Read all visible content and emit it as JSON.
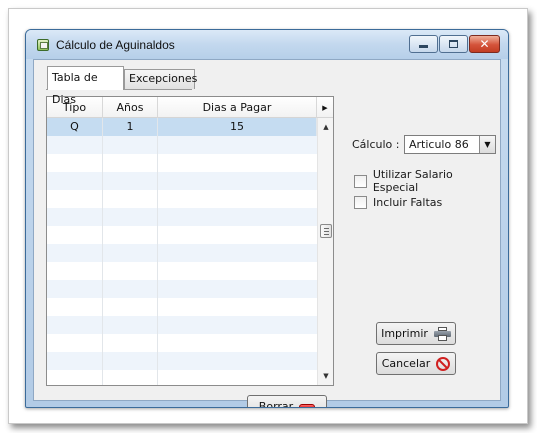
{
  "window": {
    "title": "Cálculo de Aguinaldos",
    "minimize_icon": "minimize-icon",
    "maximize_icon": "maximize-icon",
    "close_icon": "close-icon"
  },
  "tabs": [
    {
      "label": "Tabla de Dias",
      "active": true
    },
    {
      "label": "Excepciones",
      "active": false
    }
  ],
  "grid": {
    "columns": [
      "Tipo",
      "Años",
      "Dias a Pagar"
    ],
    "rows": [
      [
        "Q",
        "1",
        "15"
      ]
    ],
    "selected_row": 0
  },
  "calculo": {
    "label": "Cálculo :",
    "selected": "Articulo 86"
  },
  "options": [
    {
      "label": "Utilizar Salario Especial",
      "checked": false
    },
    {
      "label": "Incluir Faltas",
      "checked": false
    }
  ],
  "buttons": {
    "imprimir": "Imprimir",
    "cancelar": "Cancelar",
    "borrar": "Borrar"
  },
  "colors": {
    "selection": "#c5dcf1",
    "titlebar": "#c3d8ee",
    "erase": "#d40000",
    "cancel": "#d02020"
  }
}
